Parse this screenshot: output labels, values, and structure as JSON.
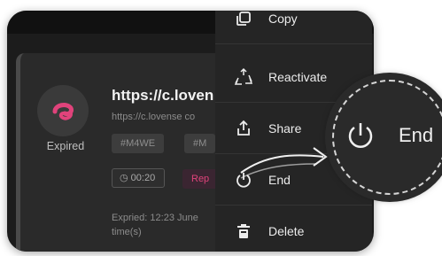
{
  "link_card": {
    "status": "Expired",
    "title": "https://c.loven",
    "subtitle": "https://c.lovense co",
    "tags": [
      "#M4WE",
      "#M"
    ],
    "timer": "00:20",
    "pink_tag": "Rep",
    "expiry_line1": "Expried: 12:23 June",
    "expiry_line2": "time(s)"
  },
  "menu": {
    "items": [
      {
        "label": "Copy",
        "icon": "copy-icon"
      },
      {
        "label": "Reactivate",
        "icon": "recycle-icon"
      },
      {
        "label": "Share",
        "icon": "share-icon"
      },
      {
        "label": "End",
        "icon": "power-icon"
      },
      {
        "label": "Delete",
        "icon": "trash-icon"
      }
    ]
  },
  "callout": {
    "label": "End",
    "icon": "power-icon"
  },
  "colors": {
    "accent_pink": "#e0437b",
    "panel": "#1c1c1c",
    "menu": "#252525"
  }
}
